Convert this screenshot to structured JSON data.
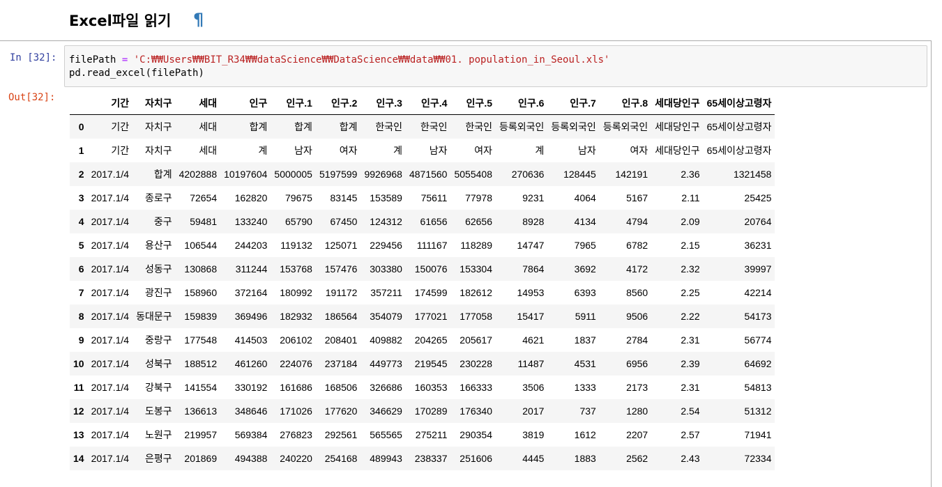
{
  "markdown": {
    "heading": "Excel파일 읽기",
    "anchor": "¶"
  },
  "input_cell": {
    "prompt": "In [32]:",
    "line1": {
      "var": "filePath",
      "op": "=",
      "string": "'C:₩₩Users₩₩BIT_R34₩₩dataScience₩₩DataScience₩₩data₩₩01. population_in_Seoul.xls'"
    },
    "line2": {
      "call": "pd.read_excel",
      "open": "(",
      "arg": "filePath",
      "close": ")"
    }
  },
  "output_cell": {
    "prompt": "Out[32]:",
    "columns": [
      "",
      "기간",
      "자치구",
      "세대",
      "인구",
      "인구.1",
      "인구.2",
      "인구.3",
      "인구.4",
      "인구.5",
      "인구.6",
      "인구.7",
      "인구.8",
      "세대당인구",
      "65세이상고령자"
    ],
    "rows": [
      [
        "0",
        "기간",
        "자치구",
        "세대",
        "합계",
        "합계",
        "합계",
        "한국인",
        "한국인",
        "한국인",
        "등록외국인",
        "등록외국인",
        "등록외국인",
        "세대당인구",
        "65세이상고령자"
      ],
      [
        "1",
        "기간",
        "자치구",
        "세대",
        "계",
        "남자",
        "여자",
        "계",
        "남자",
        "여자",
        "계",
        "남자",
        "여자",
        "세대당인구",
        "65세이상고령자"
      ],
      [
        "2",
        "2017.1/4",
        "합계",
        "4202888",
        "10197604",
        "5000005",
        "5197599",
        "9926968",
        "4871560",
        "5055408",
        "270636",
        "128445",
        "142191",
        "2.36",
        "1321458"
      ],
      [
        "3",
        "2017.1/4",
        "종로구",
        "72654",
        "162820",
        "79675",
        "83145",
        "153589",
        "75611",
        "77978",
        "9231",
        "4064",
        "5167",
        "2.11",
        "25425"
      ],
      [
        "4",
        "2017.1/4",
        "중구",
        "59481",
        "133240",
        "65790",
        "67450",
        "124312",
        "61656",
        "62656",
        "8928",
        "4134",
        "4794",
        "2.09",
        "20764"
      ],
      [
        "5",
        "2017.1/4",
        "용산구",
        "106544",
        "244203",
        "119132",
        "125071",
        "229456",
        "111167",
        "118289",
        "14747",
        "7965",
        "6782",
        "2.15",
        "36231"
      ],
      [
        "6",
        "2017.1/4",
        "성동구",
        "130868",
        "311244",
        "153768",
        "157476",
        "303380",
        "150076",
        "153304",
        "7864",
        "3692",
        "4172",
        "2.32",
        "39997"
      ],
      [
        "7",
        "2017.1/4",
        "광진구",
        "158960",
        "372164",
        "180992",
        "191172",
        "357211",
        "174599",
        "182612",
        "14953",
        "6393",
        "8560",
        "2.25",
        "42214"
      ],
      [
        "8",
        "2017.1/4",
        "동대문구",
        "159839",
        "369496",
        "182932",
        "186564",
        "354079",
        "177021",
        "177058",
        "15417",
        "5911",
        "9506",
        "2.22",
        "54173"
      ],
      [
        "9",
        "2017.1/4",
        "중랑구",
        "177548",
        "414503",
        "206102",
        "208401",
        "409882",
        "204265",
        "205617",
        "4621",
        "1837",
        "2784",
        "2.31",
        "56774"
      ],
      [
        "10",
        "2017.1/4",
        "성북구",
        "188512",
        "461260",
        "224076",
        "237184",
        "449773",
        "219545",
        "230228",
        "11487",
        "4531",
        "6956",
        "2.39",
        "64692"
      ],
      [
        "11",
        "2017.1/4",
        "강북구",
        "141554",
        "330192",
        "161686",
        "168506",
        "326686",
        "160353",
        "166333",
        "3506",
        "1333",
        "2173",
        "2.31",
        "54813"
      ],
      [
        "12",
        "2017.1/4",
        "도봉구",
        "136613",
        "348646",
        "171026",
        "177620",
        "346629",
        "170289",
        "176340",
        "2017",
        "737",
        "1280",
        "2.54",
        "51312"
      ],
      [
        "13",
        "2017.1/4",
        "노원구",
        "219957",
        "569384",
        "276823",
        "292561",
        "565565",
        "275211",
        "290354",
        "3819",
        "1612",
        "2207",
        "2.57",
        "71941"
      ],
      [
        "14",
        "2017.1/4",
        "은평구",
        "201869",
        "494388",
        "240220",
        "254168",
        "489943",
        "238337",
        "251606",
        "4445",
        "1883",
        "2562",
        "2.43",
        "72334"
      ]
    ]
  }
}
